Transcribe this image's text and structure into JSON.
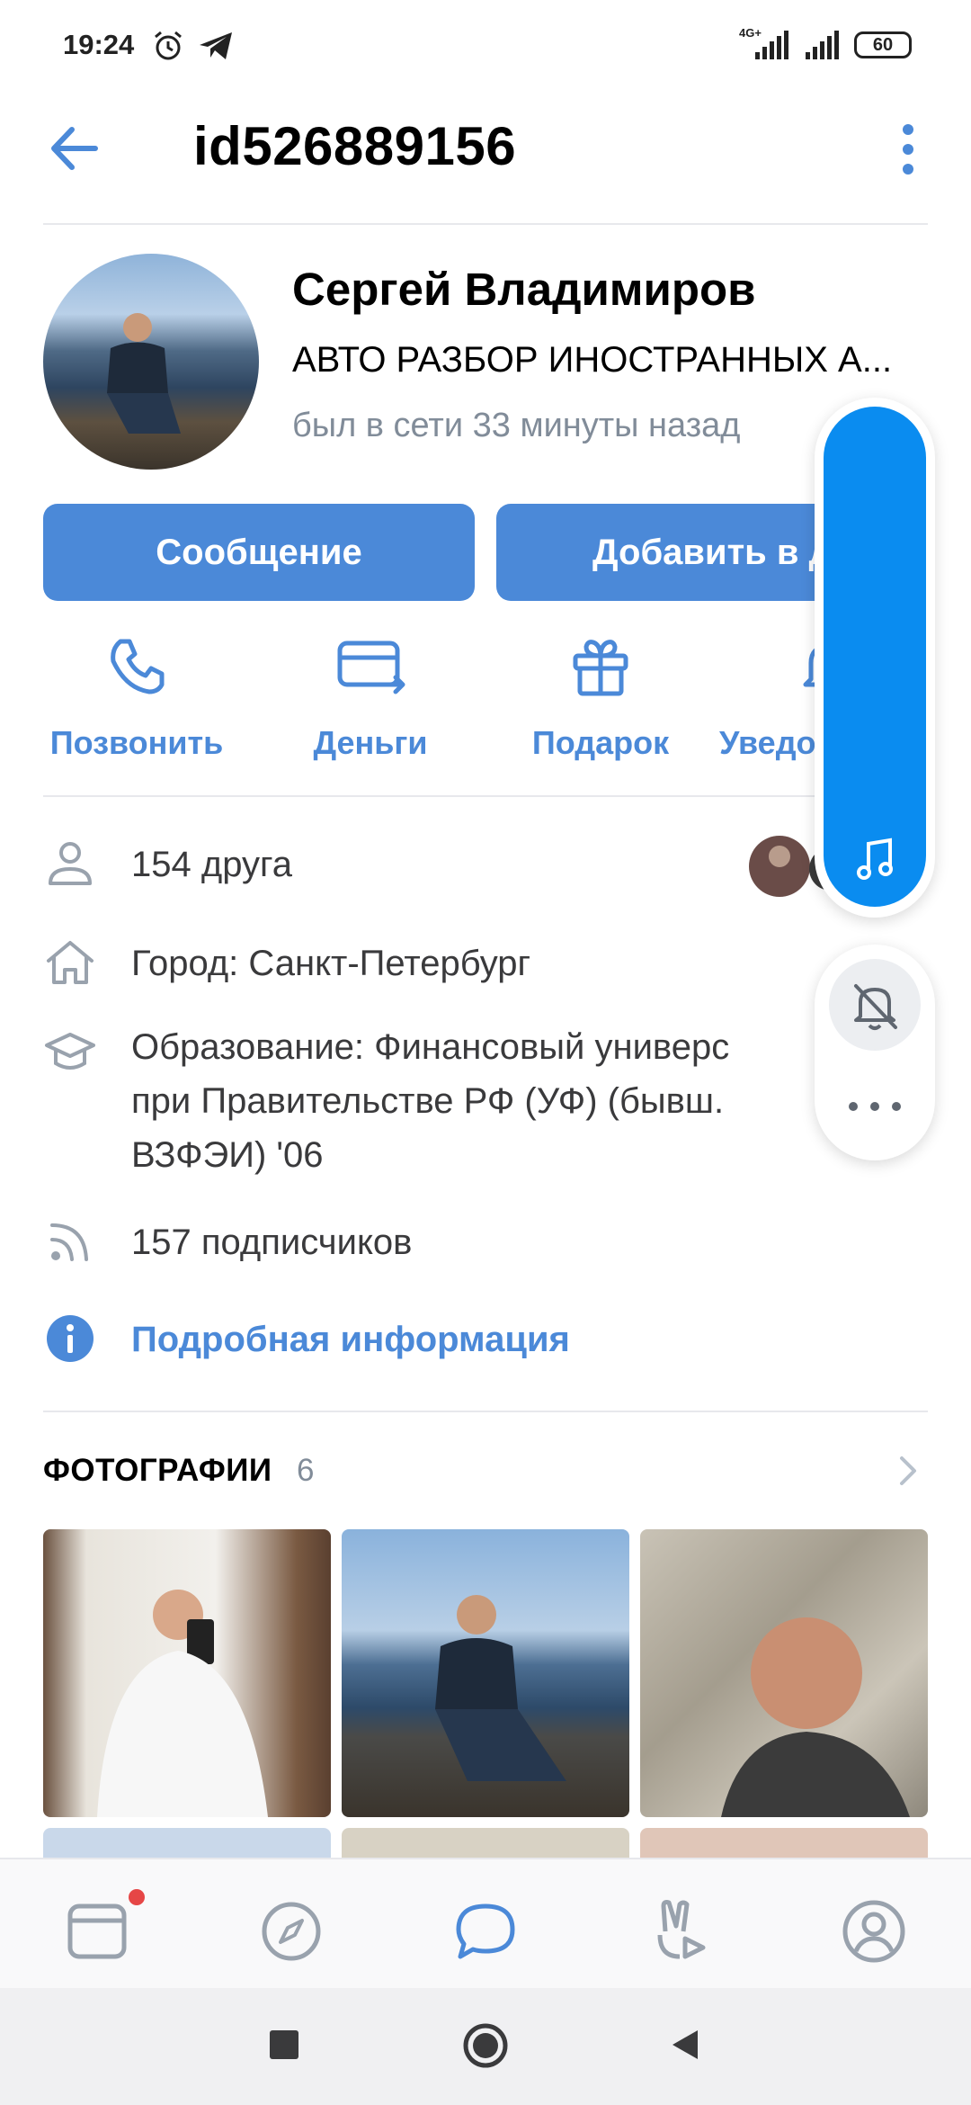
{
  "status_bar": {
    "time": "19:24",
    "network": "4G+",
    "battery": "60"
  },
  "header": {
    "title": "id526889156"
  },
  "profile": {
    "name": "Сергей Владимиров",
    "status": "АВТО РАЗБОР ИНОСТРАННЫХ А...",
    "online": "был в сети 33 минуты назад"
  },
  "buttons": {
    "message": "Сообщение",
    "add_friend": "Добавить в д"
  },
  "actions": [
    {
      "label": "Позвонить",
      "icon": "phone-icon"
    },
    {
      "label": "Деньги",
      "icon": "money-card-icon"
    },
    {
      "label": "Подарок",
      "icon": "gift-icon"
    },
    {
      "label": "Уведомления",
      "icon": "bell-icon"
    }
  ],
  "info": {
    "friends": "154 друга",
    "city": "Город: Санкт-Петербург",
    "education_line1": "Образование: Финансовый универс",
    "education_line2": "при Правительстве РФ (УФ) (бывш.",
    "education_line3": "ВЗФЭИ) '06",
    "followers": "157 подписчиков",
    "details": "Подробная информация"
  },
  "photos": {
    "title": "ФОТОГРАФИИ",
    "count": "6"
  },
  "tabbar": {
    "items": [
      "feed-icon",
      "compass-icon",
      "messages-icon",
      "clips-icon",
      "profile-icon"
    ]
  },
  "colors": {
    "accent": "#4b89d8",
    "widget_blue": "#0a8cf0",
    "secondary_text": "#818c99"
  }
}
